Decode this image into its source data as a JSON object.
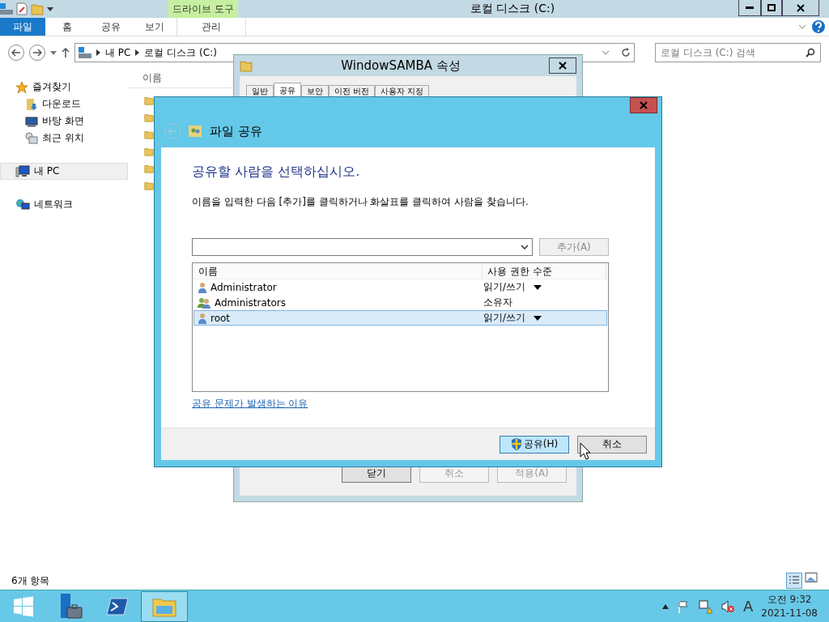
{
  "explorer": {
    "title": "로컬 디스크 (C:)",
    "context_group": "드라이브 도구",
    "ribbon_tabs": [
      {
        "label": "파일",
        "kind": "file",
        "selected": false
      },
      {
        "label": "홈",
        "kind": "tab",
        "selected": false
      },
      {
        "label": "공유",
        "kind": "tab",
        "selected": false
      },
      {
        "label": "보기",
        "kind": "tab",
        "selected": false
      },
      {
        "label": "관리",
        "kind": "context",
        "selected": false
      }
    ],
    "breadcrumb": [
      "내 PC",
      "로컬 디스크 (C:)"
    ],
    "search": {
      "placeholder": "로컬 디스크 (C:) 검색"
    },
    "nav": [
      {
        "label": "즐겨찾기",
        "kind": "star",
        "selected": false,
        "children": [
          {
            "label": "다운로드",
            "kind": "download",
            "selected": false
          },
          {
            "label": "바탕 화면",
            "kind": "desktop",
            "selected": false
          },
          {
            "label": "최근 위치",
            "kind": "recent",
            "selected": false
          }
        ]
      },
      {
        "label": "내 PC",
        "kind": "pc",
        "selected": true
      },
      {
        "label": "네트워크",
        "kind": "network",
        "selected": false
      }
    ],
    "column": "이름",
    "files": [
      {
        "kind": "folder"
      },
      {
        "kind": "folder"
      },
      {
        "kind": "folder"
      },
      {
        "kind": "folder"
      },
      {
        "kind": "folder"
      },
      {
        "kind": "folder"
      }
    ],
    "status": "6개 항목"
  },
  "properties": {
    "title": "WindowSAMBA 속성",
    "tabs": [
      {
        "label": "일반",
        "selected": false
      },
      {
        "label": "공유",
        "selected": true
      },
      {
        "label": "보안",
        "selected": false
      },
      {
        "label": "이전 버전",
        "selected": false
      },
      {
        "label": "사용자 지정",
        "selected": false
      }
    ],
    "buttons": [
      {
        "label": "닫기",
        "disabled": false
      },
      {
        "label": "취소",
        "disabled": true
      },
      {
        "label": "적용(A)",
        "disabled": true
      }
    ]
  },
  "dialog": {
    "title": "파일 공유",
    "heading": "공유할 사람을 선택하십시오.",
    "instruction": "이름을 입력한 다음 [추가]를 클릭하거나 화살표를 클릭하여 사람을 찾습니다.",
    "add_button": {
      "label": "추가(A)",
      "disabled": true
    },
    "columns": [
      "이름",
      "사용 권한 수준"
    ],
    "rows": [
      {
        "name": "Administrator",
        "kind": "user",
        "permission": "읽기/쓰기",
        "dropdown": true,
        "selected": false
      },
      {
        "name": "Administrators",
        "kind": "group",
        "permission": "소유자",
        "dropdown": false,
        "selected": false
      },
      {
        "name": "root",
        "kind": "user",
        "permission": "읽기/쓰기",
        "dropdown": true,
        "selected": true
      }
    ],
    "link": "공유 문제가 발생하는 이유",
    "buttons": [
      {
        "label": "공유(H)",
        "kind": "shield",
        "focused": true
      },
      {
        "label": "취소",
        "kind": "plain",
        "focused": false
      }
    ]
  },
  "taskbar": {
    "apps": [
      {
        "kind": "start",
        "selected": false
      },
      {
        "kind": "server",
        "selected": false
      },
      {
        "kind": "powershell",
        "selected": false
      },
      {
        "kind": "explorer",
        "selected": true
      }
    ],
    "ime": "A",
    "time": "오전 9:32",
    "date": "2021-11-08"
  }
}
